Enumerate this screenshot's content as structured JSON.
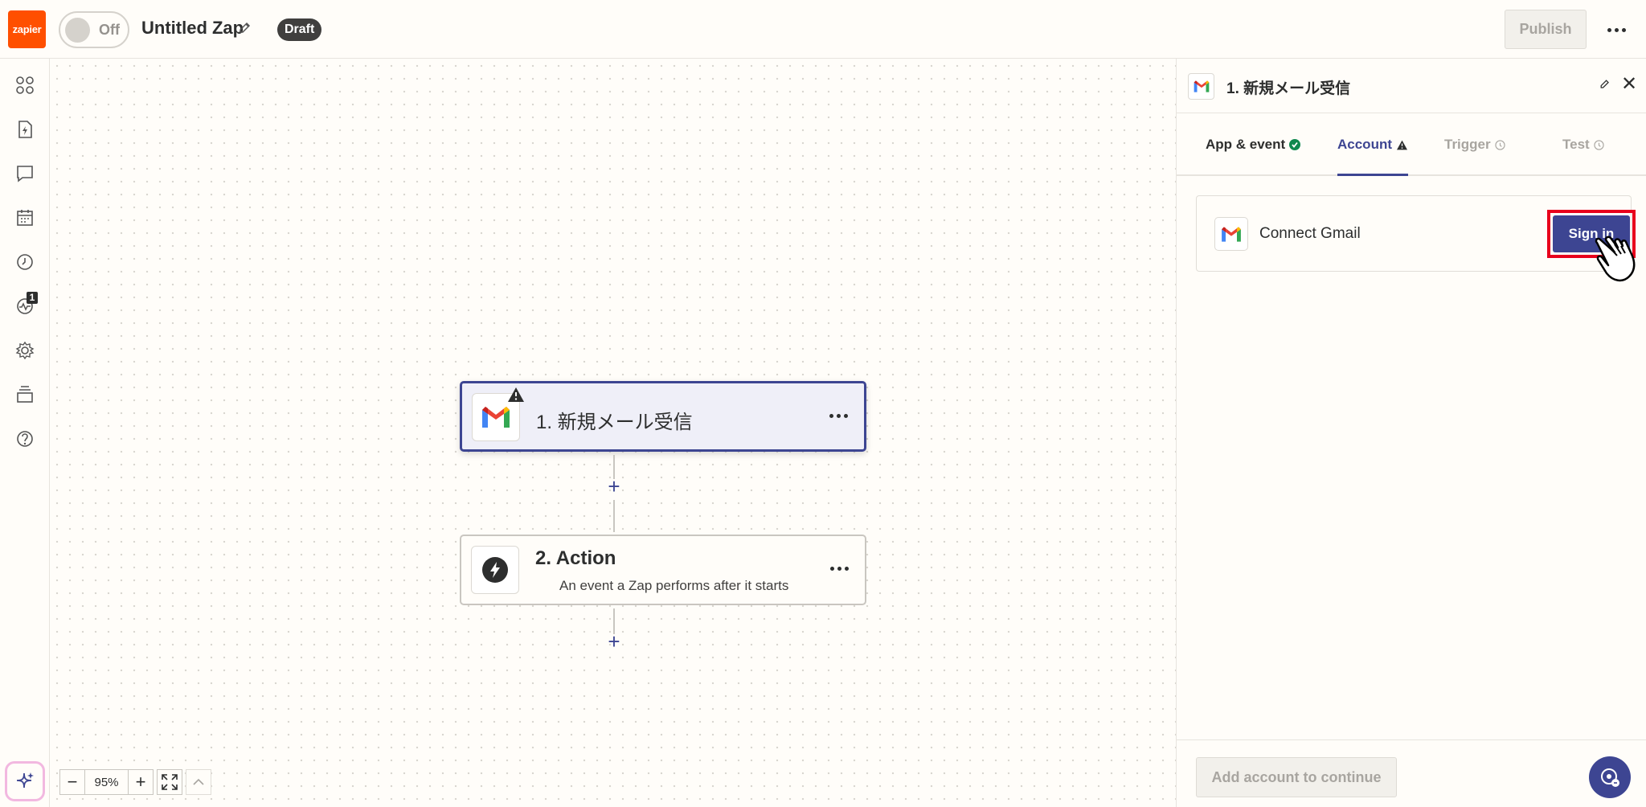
{
  "topbar": {
    "logo_text": "zapier",
    "toggle_label": "Off",
    "zap_title": "Untitled Zap",
    "status_badge": "Draft",
    "publish_label": "Publish"
  },
  "rail": {
    "badge_count": "1",
    "icons": [
      "apps-icon",
      "zap-file-icon",
      "comment-icon",
      "calendar-icon",
      "history-icon",
      "activity-icon",
      "settings-icon",
      "versions-icon",
      "help-icon"
    ]
  },
  "canvas": {
    "nodes": [
      {
        "title": "1. 新規メール受信",
        "app": "gmail",
        "warning": true
      },
      {
        "title": "2. Action",
        "subtitle": "An event a Zap performs after it starts",
        "app": "action"
      }
    ],
    "zoom_level": "95%"
  },
  "panel": {
    "title": "1. 新規メール受信",
    "tabs": [
      {
        "label": "App & event",
        "status": "complete"
      },
      {
        "label": "Account",
        "status": "warning",
        "active": true
      },
      {
        "label": "Trigger",
        "status": "pending"
      },
      {
        "label": "Test",
        "status": "pending"
      }
    ],
    "connect_label": "Connect Gmail",
    "signin_label": "Sign in",
    "continue_label": "Add account to continue"
  },
  "colors": {
    "brand": "#ff4f00",
    "accent": "#3d4592",
    "highlight": "#e8001c",
    "success": "#0f884e"
  }
}
